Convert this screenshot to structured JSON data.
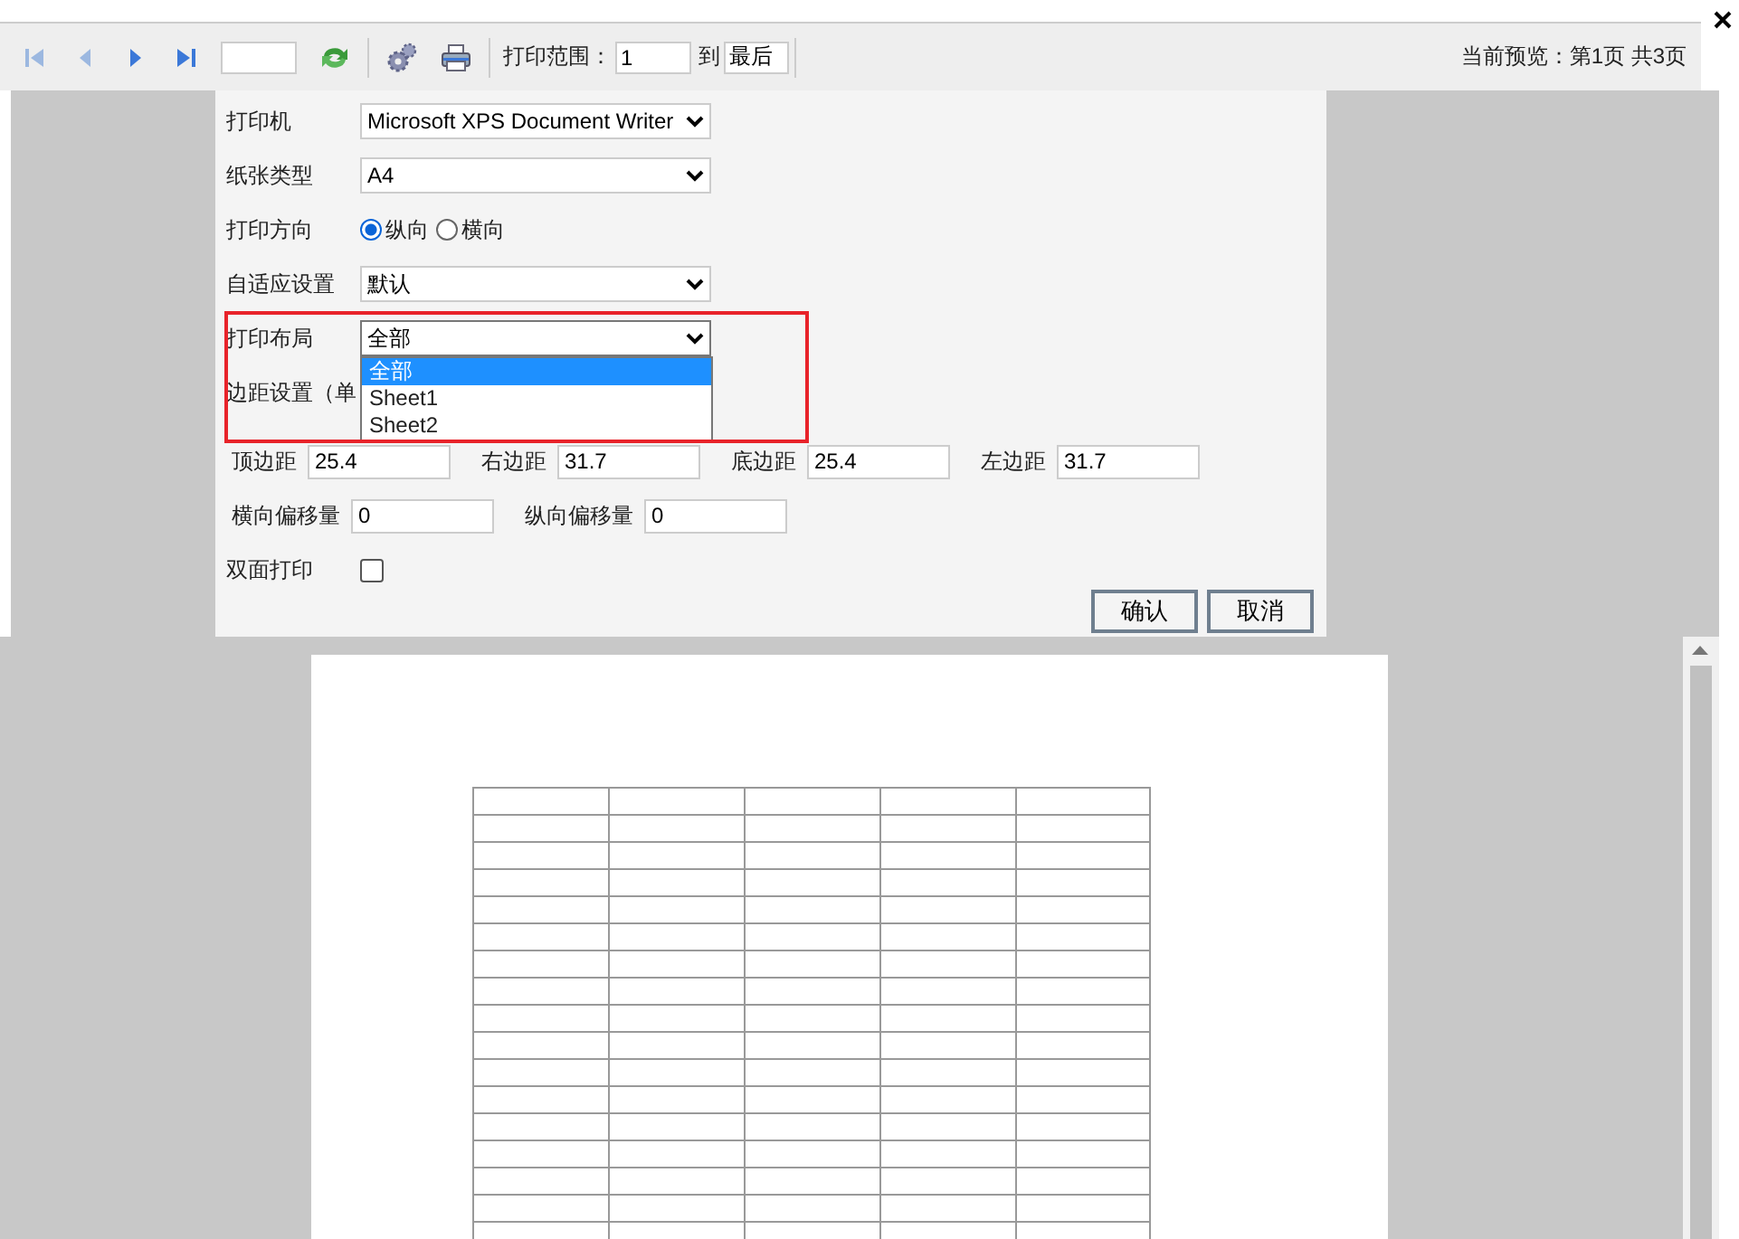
{
  "toolbar": {
    "nav_buttons": [
      {
        "kind": "first",
        "disabled": true
      },
      {
        "kind": "prev",
        "disabled": true
      },
      {
        "kind": "next",
        "disabled": false
      },
      {
        "kind": "last",
        "disabled": false
      }
    ],
    "range_label": "打印范围：",
    "range_from": "1",
    "range_to_label": "到",
    "range_to": "最后",
    "preview_status": "当前预览：第1页 共3页"
  },
  "dialog": {
    "fields": [
      {
        "kind": "select",
        "label": "打印机",
        "value": "Microsoft XPS Document Writer"
      },
      {
        "kind": "select",
        "label": "纸张类型",
        "value": "A4"
      },
      {
        "kind": "radio",
        "label": "打印方向",
        "options": [
          {
            "label": "纵向",
            "selected": true
          },
          {
            "label": "横向",
            "selected": false
          }
        ]
      },
      {
        "kind": "select",
        "label": "自适应设置",
        "value": "默认"
      },
      {
        "kind": "select",
        "label": "打印布局",
        "value": "全部",
        "expanded": true,
        "options": [
          {
            "label": "全部",
            "selected": true
          },
          {
            "label": "Sheet1",
            "selected": false
          },
          {
            "label": "Sheet2",
            "selected": false
          }
        ]
      },
      {
        "kind": "heading",
        "label": "边距设置（单"
      },
      {
        "kind": "inputs",
        "items": [
          {
            "label": "顶边距",
            "value": "25.4"
          },
          {
            "label": "右边距",
            "value": "31.7"
          },
          {
            "label": "底边距",
            "value": "25.4"
          },
          {
            "label": "左边距",
            "value": "31.7"
          }
        ]
      },
      {
        "kind": "inputs",
        "items": [
          {
            "label": "横向偏移量",
            "value": "0"
          },
          {
            "label": "纵向偏移量",
            "value": "0"
          }
        ]
      },
      {
        "kind": "checkbox",
        "label": "双面打印",
        "checked": false
      }
    ],
    "buttons": [
      "确认",
      "取消"
    ]
  }
}
